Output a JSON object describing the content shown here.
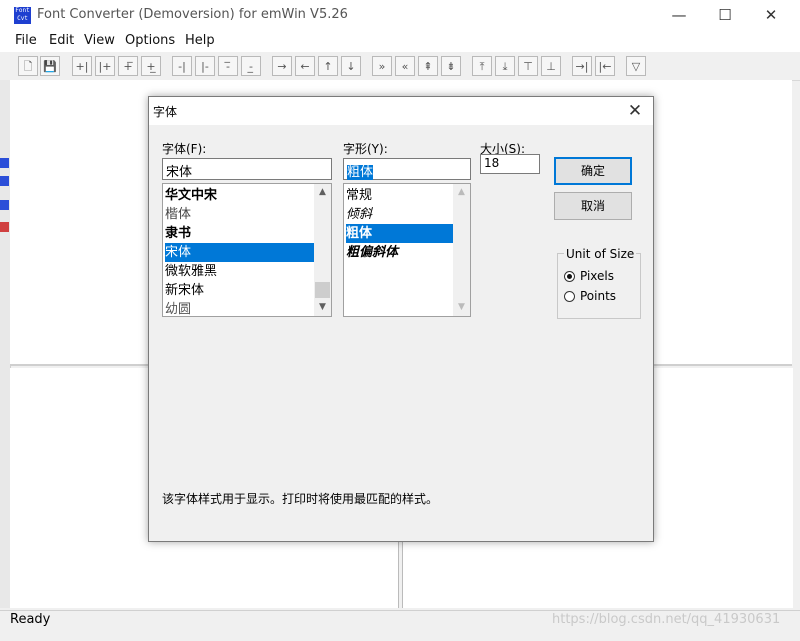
{
  "window": {
    "title": "Font Converter (Demoversion) for emWin V5.26",
    "icon_text": "Font Cvt",
    "controls": {
      "minimize": "—",
      "maximize": "☐",
      "close": "✕"
    }
  },
  "menu": [
    "File",
    "Edit",
    "View",
    "Options",
    "Help"
  ],
  "toolbar": {
    "buttons": [
      "new-file",
      "save",
      "add-col",
      "add-col-right",
      "add-row-top",
      "add-row-bottom",
      "del-col-left",
      "del-col-right",
      "del-row-top",
      "del-row-bottom",
      "arrow-right",
      "arrow-left",
      "arrow-up",
      "arrow-down",
      "fast-right",
      "fast-left",
      "fast-up",
      "fast-down",
      "move-top",
      "move-bottom",
      "move-up-bar",
      "move-down-bar",
      "push-right",
      "push-left",
      "filter"
    ],
    "glyphs": [
      "🗋",
      "💾",
      "+|",
      "|+",
      "+̅",
      "+̲",
      "-|",
      "|-",
      "-̅",
      "-̲",
      "→",
      "←",
      "↑",
      "↓",
      "»",
      "«",
      "⇞",
      "⇟",
      "⤒",
      "⤓",
      "⊤",
      "⊥",
      "→|",
      "|←",
      "▽"
    ]
  },
  "status": {
    "text": "Ready"
  },
  "watermark": "https://blog.csdn.net/qq_41930631",
  "dialog": {
    "title": "字体",
    "close": "✕",
    "font": {
      "label": "字体(F):",
      "value": "宋体",
      "items": [
        "华文中宋",
        "楷体",
        "隶书",
        "宋体",
        "微软雅黑",
        "新宋体",
        "幼圆"
      ],
      "selected": "宋体"
    },
    "style": {
      "label": "字形(Y):",
      "value": "粗体",
      "items": [
        "常规",
        "倾斜",
        "粗体",
        "粗偏斜体"
      ],
      "selected": "粗体"
    },
    "size": {
      "label": "大小(S):",
      "value": "18"
    },
    "ok_label": "确定",
    "cancel_label": "取消",
    "unit": {
      "label": "Unit of Size",
      "options": [
        "Pixels",
        "Points"
      ],
      "selected": "Pixels"
    },
    "description": "该字体样式用于显示。打印时将使用最匹配的样式。"
  }
}
